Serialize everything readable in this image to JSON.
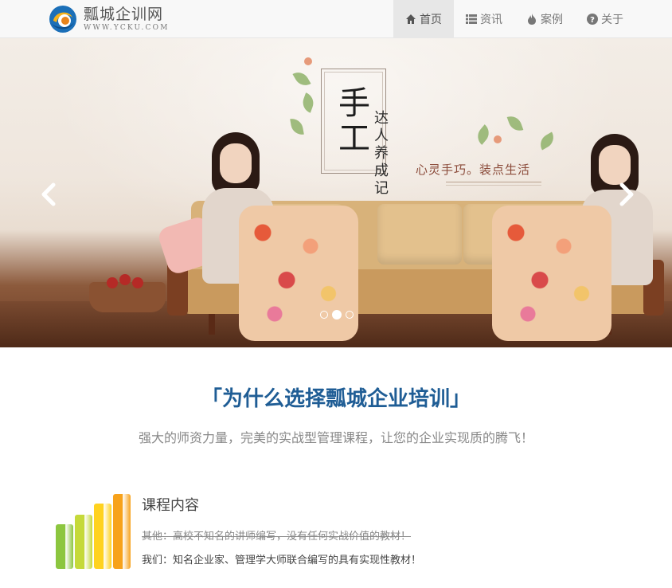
{
  "header": {
    "logo_title": "瓢城企训网",
    "logo_subtitle": "WWW.YCKU.COM",
    "nav": [
      {
        "label": "首页",
        "icon": "home-icon",
        "active": true
      },
      {
        "label": "资讯",
        "icon": "list-icon",
        "active": false
      },
      {
        "label": "案例",
        "icon": "fire-icon",
        "active": false
      },
      {
        "label": "关于",
        "icon": "question-circle-icon",
        "active": false
      }
    ]
  },
  "banner": {
    "big_title": "手工",
    "vertical_subtitle": "达人养成记",
    "slogan": "心灵手巧。装点生活",
    "active_slide": 2,
    "slide_count": 3
  },
  "section": {
    "title": "「为什么选择瓢城企业培训」",
    "subtitle": "强大的师资力量，完美的实战型管理课程，让您的企业实现质的腾飞！"
  },
  "feature": {
    "title": "课程内容",
    "old_text": "其他：高校不知名的讲师编写，没有任何实战价值的教材！",
    "new_text": "我们：知名企业家、管理学大师联合编写的具有实现性教材！",
    "icon_colors": [
      "#8cc63f",
      "#c5d93a",
      "#ffd21f",
      "#f7a21b"
    ]
  },
  "colors": {
    "accent_blue": "#1f5d95",
    "nav_bg": "#f8f8f8",
    "nav_active_bg": "#e7e7e7"
  }
}
